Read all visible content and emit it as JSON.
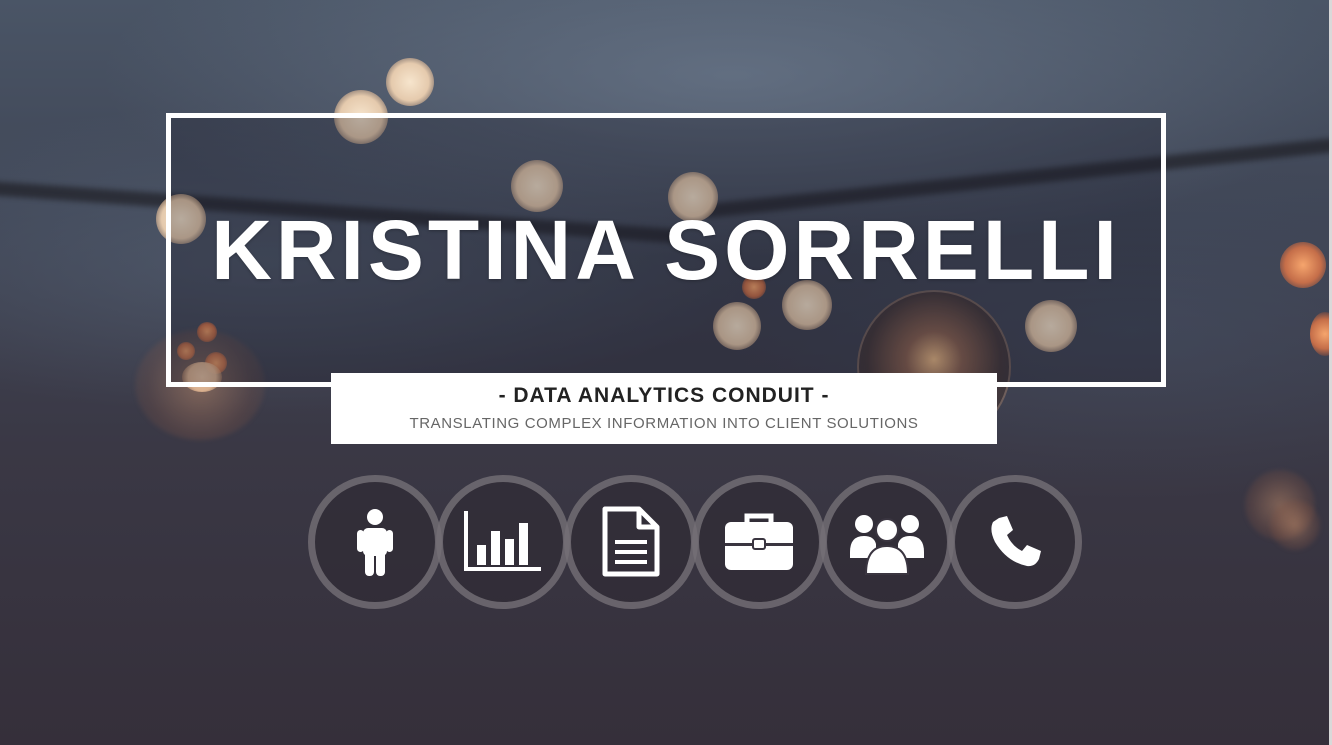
{
  "hero": {
    "name": "KRISTINA SORRELLI",
    "subtitle": "- DATA ANALYTICS CONDUIT -",
    "tagline": "TRANSLATING COMPLEX INFORMATION INTO CLIENT SOLUTIONS"
  },
  "nav_icons": [
    {
      "icon": "person-icon"
    },
    {
      "icon": "bar-chart-icon"
    },
    {
      "icon": "document-icon"
    },
    {
      "icon": "briefcase-icon"
    },
    {
      "icon": "group-icon"
    },
    {
      "icon": "phone-icon"
    }
  ],
  "colors": {
    "text_primary": "#ffffff",
    "subtitle_text": "#222222",
    "tagline_text": "#666666",
    "icon_ring": "#969196"
  }
}
